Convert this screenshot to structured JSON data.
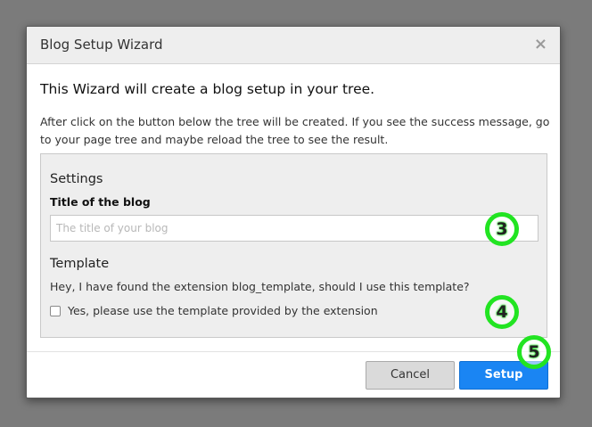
{
  "dialog": {
    "title": "Blog Setup Wizard",
    "close_glyph": "×",
    "intro_heading": "This Wizard will create a blog setup in your tree.",
    "intro_text": "After click on the button below the tree will be created. If you see the success message, go to your page tree and maybe reload the tree to see the result."
  },
  "settings": {
    "heading": "Settings",
    "title_label": "Title of the blog",
    "title_placeholder": "The title of your blog",
    "title_value": ""
  },
  "template": {
    "heading": "Template",
    "question": "Hey, I have found the extension blog_template, should I use this template?",
    "checkbox_label": "Yes, please use the template provided by the extension",
    "checkbox_checked": false
  },
  "footer": {
    "cancel_label": "Cancel",
    "setup_label": "Setup"
  },
  "markers": [
    "3",
    "4",
    "5"
  ],
  "colors": {
    "overlay": "#7b7b7b",
    "primary": "#1a85f3",
    "marker_ring": "#22e422"
  }
}
